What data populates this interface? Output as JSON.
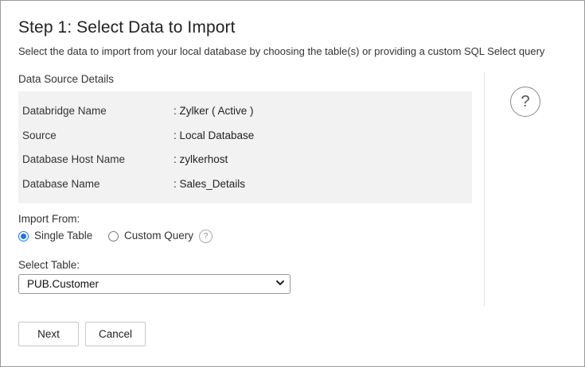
{
  "header": {
    "title": "Step 1: Select Data to Import",
    "subtitle": "Select the data to import from your local database by choosing the table(s) or providing a custom SQL Select query"
  },
  "data_source": {
    "heading": "Data Source Details",
    "rows": [
      {
        "label": "Databridge Name",
        "value": ": Zylker ( Active )"
      },
      {
        "label": "Source",
        "value": ": Local Database"
      },
      {
        "label": "Database Host Name",
        "value": ": zylkerhost"
      },
      {
        "label": "Database Name",
        "value": ": Sales_Details"
      }
    ]
  },
  "help": {
    "large_icon_glyph": "?",
    "small_icon_glyph": "?"
  },
  "import_from": {
    "label": "Import From:",
    "options": [
      {
        "label": "Single Table",
        "checked": true
      },
      {
        "label": "Custom Query",
        "checked": false
      }
    ]
  },
  "select_table": {
    "label": "Select Table:",
    "value": "PUB.Customer"
  },
  "actions": {
    "next_label": "Next",
    "cancel_label": "Cancel"
  },
  "colors": {
    "accent": "#1a73e8",
    "details_bg": "#f2f2f2",
    "border": "#9a9a9a"
  }
}
